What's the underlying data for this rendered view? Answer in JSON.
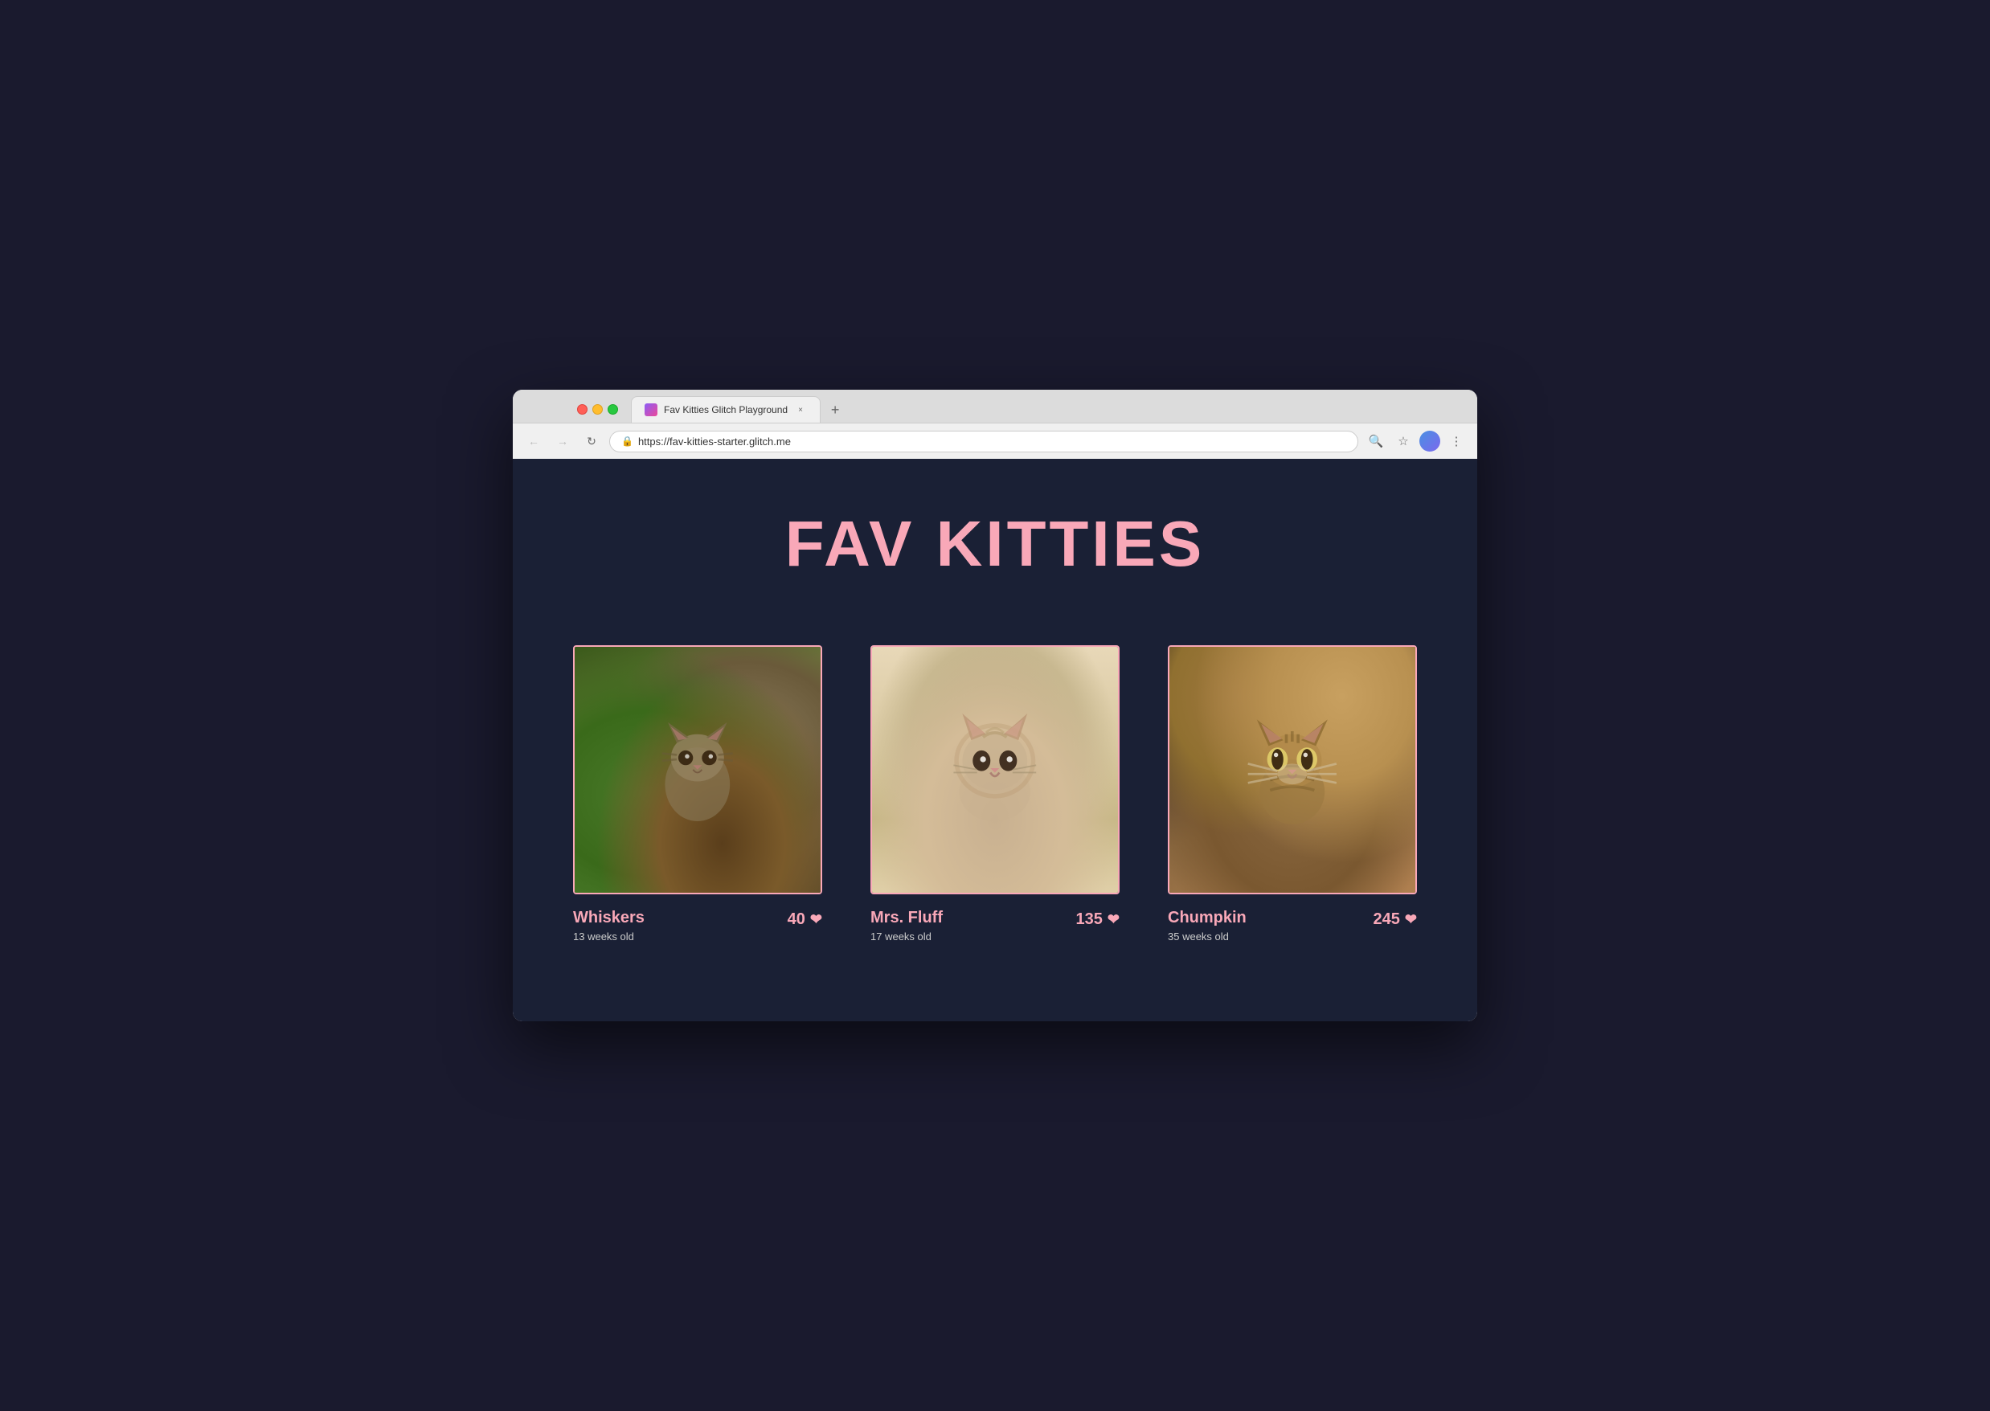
{
  "browser": {
    "tab_title": "Fav Kitties Glitch Playground",
    "tab_close": "×",
    "new_tab": "+",
    "url": "https://fav-kitties-starter.glitch.me",
    "nav": {
      "back": "←",
      "forward": "→",
      "reload": "↻"
    },
    "toolbar": {
      "search": "🔍",
      "bookmark": "☆",
      "menu": "⋮"
    }
  },
  "page": {
    "title": "FAV KITTIES",
    "kitties": [
      {
        "id": "whiskers",
        "name": "Whiskers",
        "age": "13 weeks old",
        "votes": "40",
        "heart": "❤"
      },
      {
        "id": "mrs-fluff",
        "name": "Mrs. Fluff",
        "age": "17 weeks old",
        "votes": "135",
        "heart": "❤"
      },
      {
        "id": "chumpkin",
        "name": "Chumpkin",
        "age": "35 weeks old",
        "votes": "245",
        "heart": "❤"
      }
    ]
  }
}
